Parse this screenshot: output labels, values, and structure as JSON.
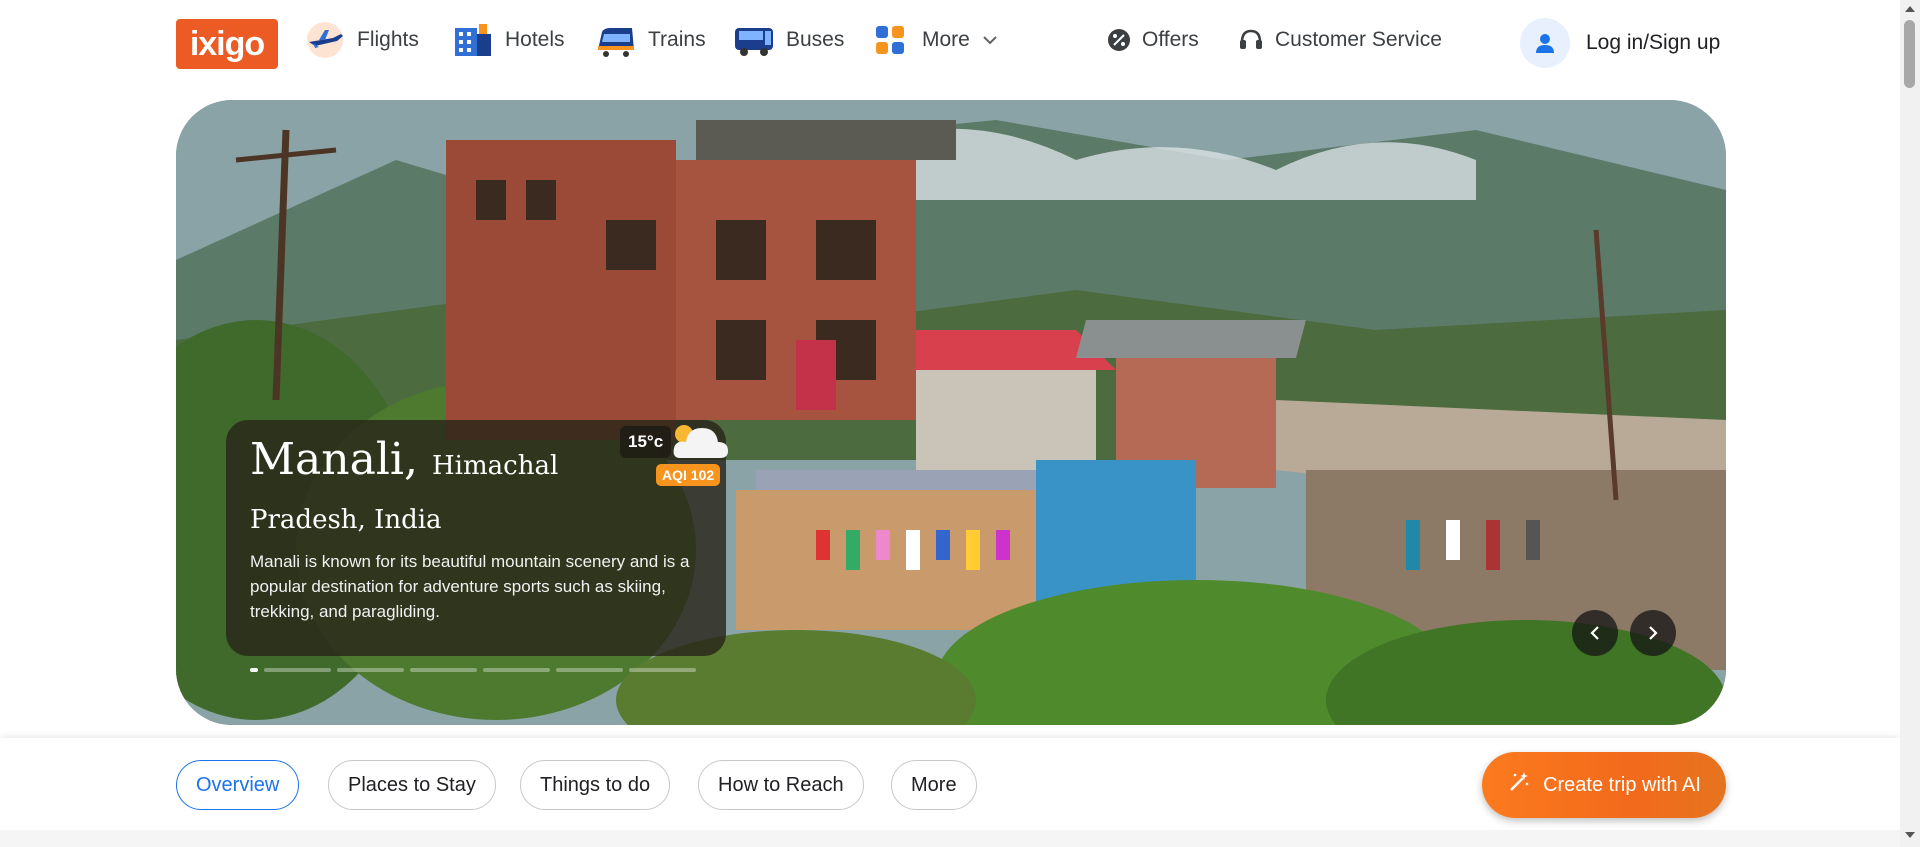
{
  "header": {
    "logo_text": "ixigo",
    "nav": [
      {
        "label": "Flights",
        "icon": "plane-icon"
      },
      {
        "label": "Hotels",
        "icon": "hotel-icon"
      },
      {
        "label": "Trains",
        "icon": "train-icon"
      },
      {
        "label": "Buses",
        "icon": "bus-icon"
      },
      {
        "label": "More",
        "icon": "grid-icon"
      }
    ],
    "offers_label": "Offers",
    "customer_service_label": "Customer Service",
    "login_label": "Log in/Sign up"
  },
  "hero": {
    "city": "Manali,",
    "region": "Himachal",
    "country": "Pradesh, India",
    "description": "Manali is known for its beautiful mountain scenery and is a popular destination for adventure sports such as skiing, trekking, and paragliding.",
    "weather": {
      "temp": "15°c",
      "aqi_label": "AQI",
      "aqi_value": "102",
      "icon": "cloud-sun-icon"
    },
    "slides_count": 7,
    "active_slide": 1
  },
  "tabs": [
    {
      "label": "Overview",
      "active": true
    },
    {
      "label": "Places to Stay",
      "active": false
    },
    {
      "label": "Things to do",
      "active": false
    },
    {
      "label": "How to Reach",
      "active": false
    },
    {
      "label": "More",
      "active": false
    }
  ],
  "cta": {
    "label": "Create trip with AI",
    "icon": "magic-wand-icon"
  },
  "colors": {
    "brand": "#ec5b24",
    "accent_blue": "#1a73e8",
    "cta_orange": "#f26a1b"
  }
}
